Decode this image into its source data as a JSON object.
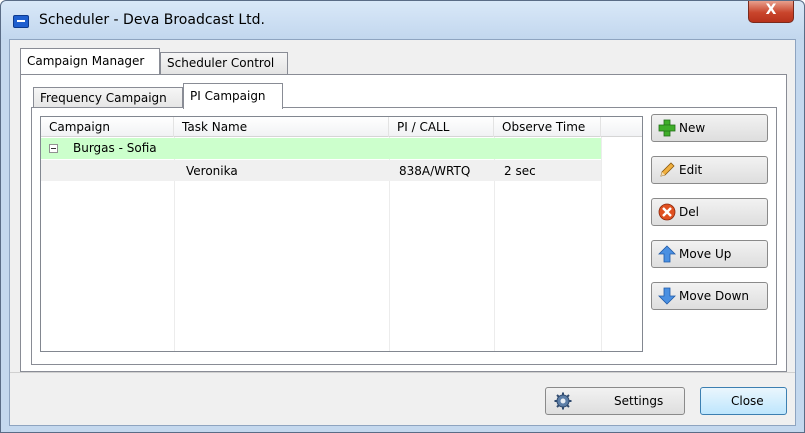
{
  "window": {
    "title": "Scheduler - Deva Broadcast Ltd.",
    "close_glyph": "X"
  },
  "tabs": [
    {
      "label": "Campaign Manager",
      "active": true
    },
    {
      "label": "Scheduler Control",
      "active": false
    }
  ],
  "subtabs": [
    {
      "label": "Frequency Campaign",
      "active": false
    },
    {
      "label": "PI Campaign",
      "active": true
    }
  ],
  "table": {
    "columns": [
      "Campaign",
      "Task Name",
      "PI / CALL",
      "Observe Time"
    ],
    "group": {
      "label": "Burgas - Sofia",
      "expander": "minus",
      "color": "#ccffcc"
    },
    "rows": [
      {
        "campaign": "",
        "task_name": "Veronika",
        "pi_call": "838A/WRTQ",
        "observe_time": "2 sec"
      }
    ]
  },
  "actions": [
    {
      "label": "New",
      "icon": "plus-icon",
      "color": "#3fae29"
    },
    {
      "label": "Edit",
      "icon": "pencil-icon",
      "color": "#e0a030"
    },
    {
      "label": "Del",
      "icon": "delete-x-icon",
      "color": "#e05020"
    },
    {
      "label": "Move Up",
      "icon": "arrow-up-icon",
      "color": "#3a80d8"
    },
    {
      "label": "Move Down",
      "icon": "arrow-down-icon",
      "color": "#3a80d8"
    }
  ],
  "footer": {
    "settings_label": "Settings",
    "settings_icon": "gear-icon",
    "close_label": "Close"
  }
}
